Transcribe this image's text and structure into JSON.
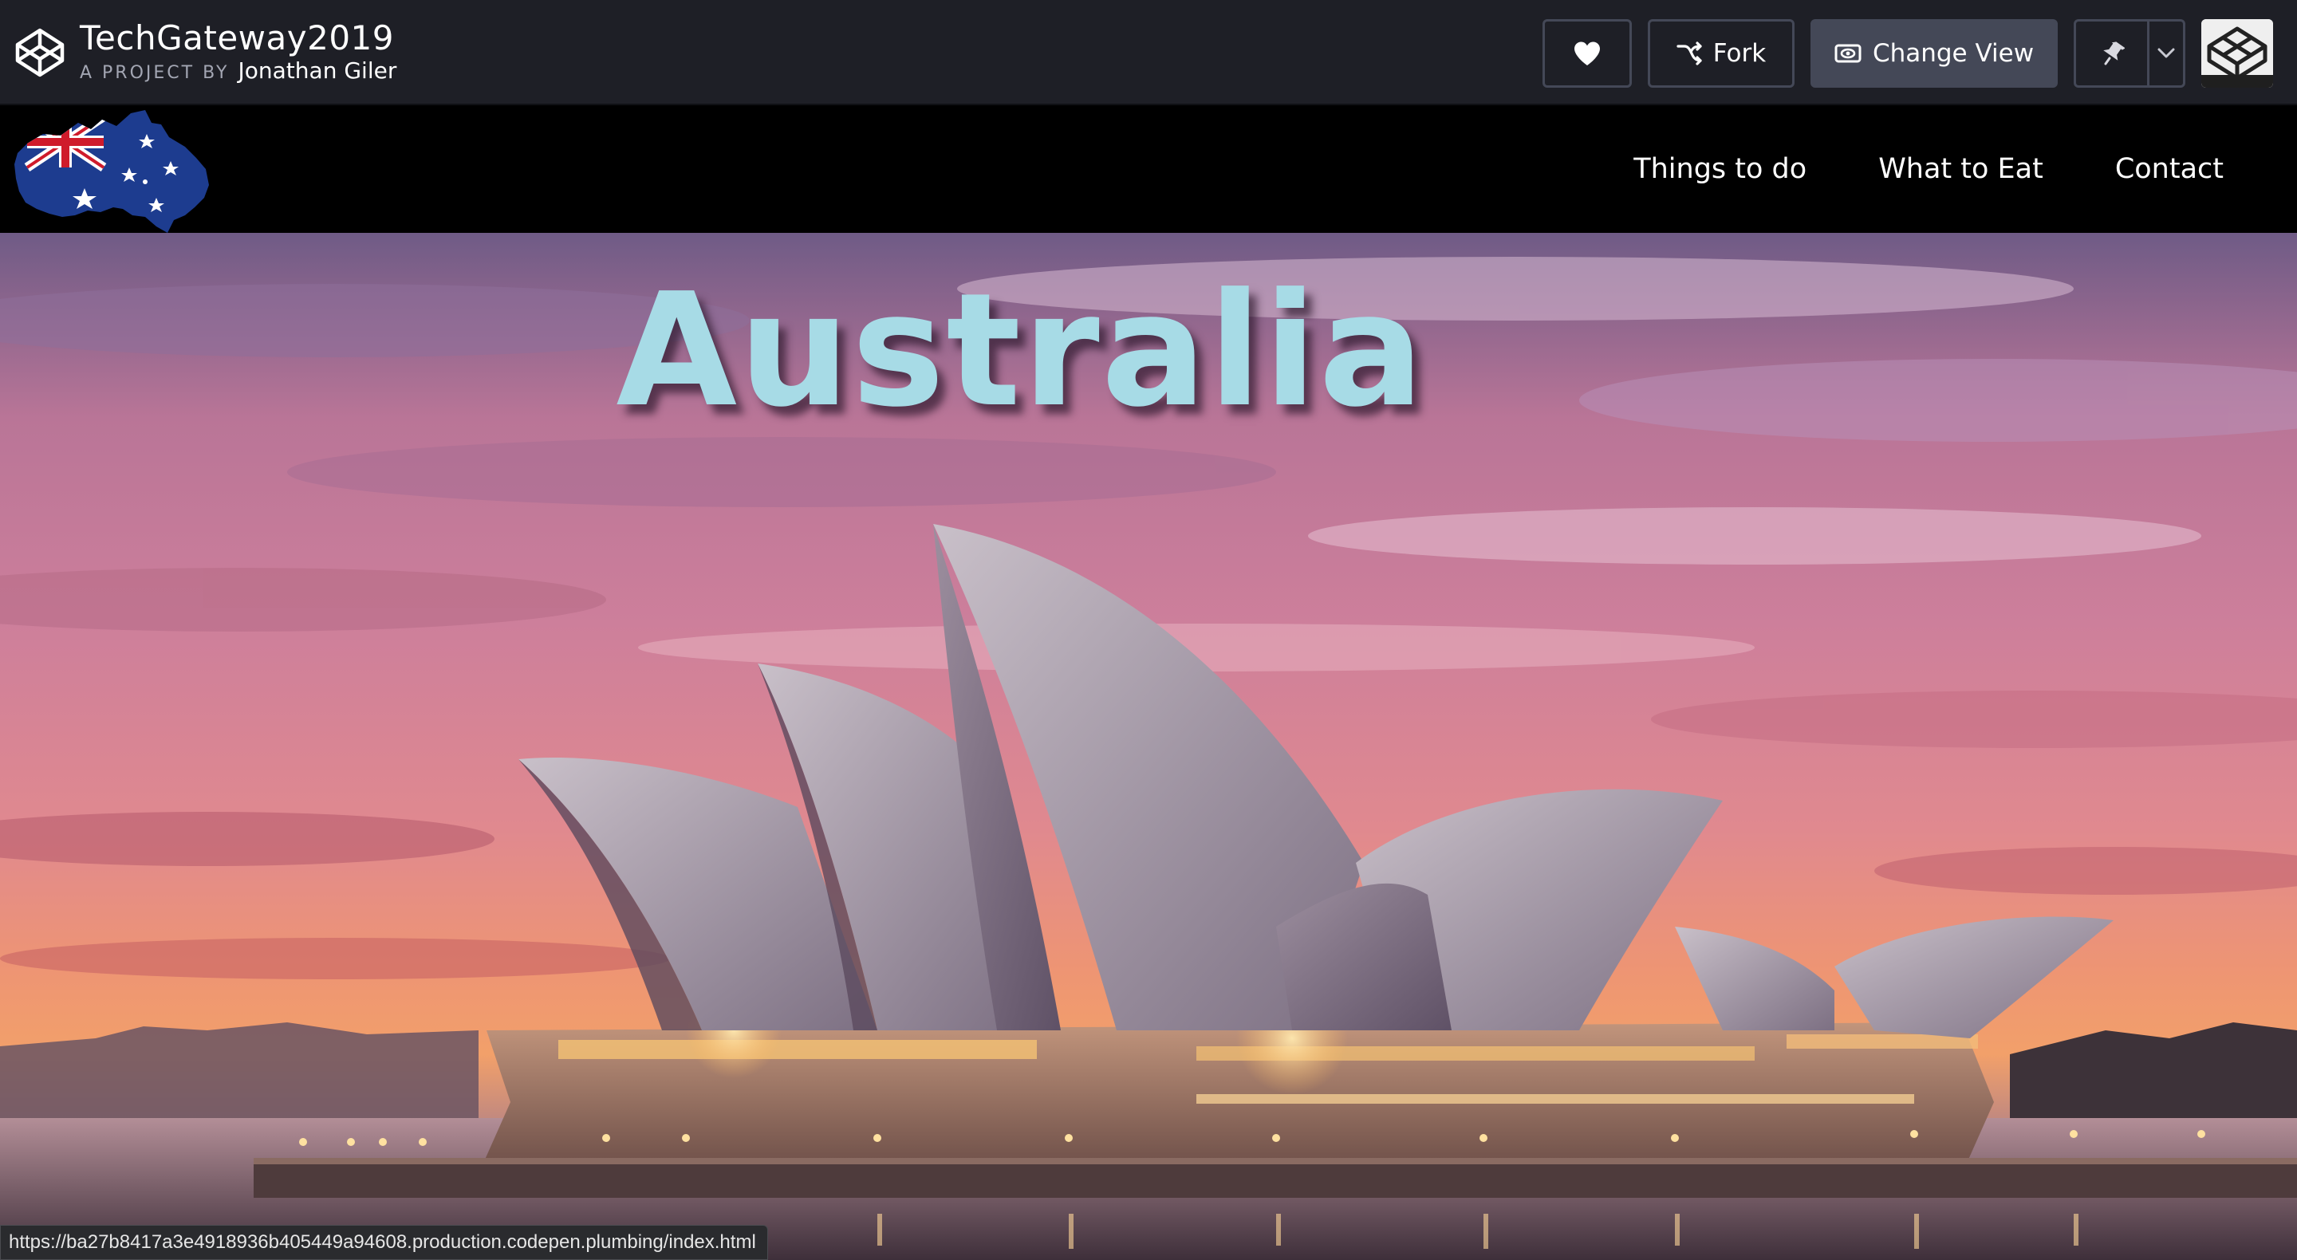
{
  "codepen_bar": {
    "project_title": "TechGateway2019",
    "subtitle_prefix": "A PROJECT BY",
    "author": "Jonathan Giler",
    "buttons": {
      "like_icon": "heart-icon",
      "fork_label": "Fork",
      "fork_icon": "fork-icon",
      "change_view_label": "Change View",
      "change_view_icon": "eye-icon",
      "pin_icon": "pin-icon",
      "pin_menu_icon": "chevron-down-icon"
    }
  },
  "site": {
    "nav": {
      "logo": "australia-flag-map",
      "links": [
        "Things to do",
        "What to Eat",
        "Contact"
      ]
    },
    "hero": {
      "title": "Australia",
      "image": "sydney-opera-house-at-sunset"
    }
  },
  "status_bar": {
    "url": "https://ba27b8417a3e4918936b405449a94608.production.codepen.plumbing/index.html"
  },
  "colors": {
    "codepen_bar_bg": "#1e1f26",
    "button_border": "#444857",
    "nav_bg": "#000000",
    "hero_title": "#a7dbe6"
  }
}
